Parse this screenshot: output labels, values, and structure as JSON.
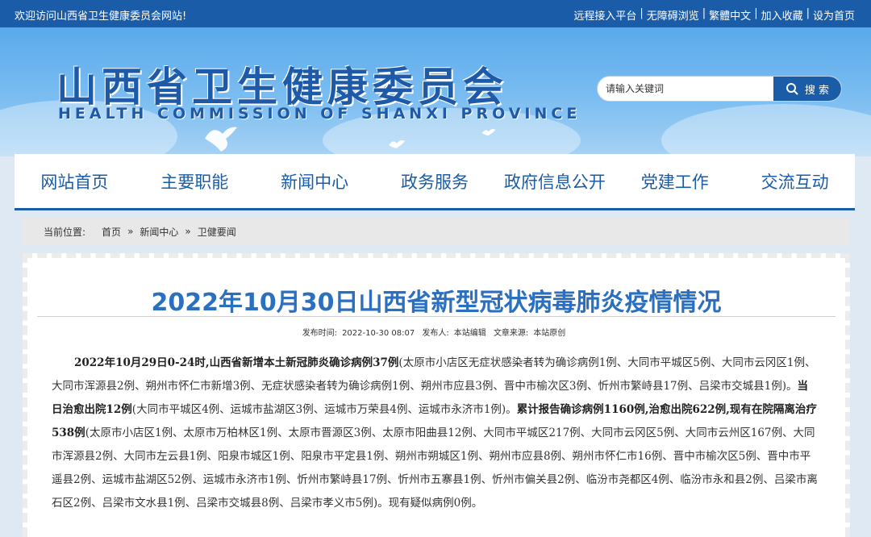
{
  "topbar": {
    "welcome": "欢迎访问山西省卫生健康委员会网站!",
    "links": [
      "远程接入平台",
      "无障碍浏览",
      "繁體中文",
      "加入收藏",
      "设为首页"
    ]
  },
  "header": {
    "title_cn": "山西省卫生健康委员会",
    "title_en": "HEALTH COMMISSION OF SHANXI PROVINCE",
    "search_placeholder": "请输入关键词",
    "search_button": "搜 索"
  },
  "nav": {
    "items": [
      "网站首页",
      "主要职能",
      "新闻中心",
      "政务服务",
      "政府信息公开",
      "党建工作",
      "交流互动"
    ]
  },
  "breadcrumb": {
    "label": "当前位置:",
    "items": [
      "首页",
      "新闻中心",
      "卫健要闻"
    ],
    "separator": "»"
  },
  "article": {
    "title": "2022年10月30日山西省新型冠状病毒肺炎疫情情况",
    "meta_time_label": "发布时间:",
    "meta_time": "2022-10-30 08:07",
    "meta_author_label": "发布人:",
    "meta_author": "本站编辑",
    "meta_source_label": "文章来源:",
    "meta_source": "本站原创",
    "p1_b1": "2022年10月29日0-24时,山西省新增本土新冠肺炎确诊病例37例",
    "p1_t1": "(太原市小店区无症状感染者转为确诊病例1例、大同市平城区5例、大同市云冈区1例、大同市浑源县2例、朔州市怀仁市新增3例、无症状感染者转为确诊病例1例、朔州市应县3例、晋中市榆次区3例、忻州市繁峙县17例、吕梁市交城县1例)。",
    "p1_b2": "当日治愈出院12例",
    "p1_t2": "(大同市平城区4例、运城市盐湖区3例、运城市万荣县4例、运城市永济市1例)。",
    "p1_b3": "累计报告确诊病例1160例,治愈出院622例,现有在院隔离治疗538例",
    "p1_t3": "(太原市小店区1例、太原市万柏林区1例、太原市晋源区3例、太原市阳曲县12例、大同市平城区217例、大同市云冈区5例、大同市云州区167例、大同市浑源县2例、大同市左云县1例、阳泉市城区1例、阳泉市平定县1例、朔州市朔城区1例、朔州市应县8例、朔州市怀仁市16例、晋中市榆次区5例、晋中市平遥县2例、运城市盐湖区52例、运城市永济市1例、忻州市繁峙县17例、忻州市五寨县1例、忻州市偏关县2例、临汾市尧都区4例、临汾市永和县2例、吕梁市离石区2例、吕梁市文水县1例、吕梁市交城县8例、吕梁市孝义市5例)。现有疑似病例0例。"
  },
  "colors": {
    "primary": "#1a5ca8",
    "title": "#2a6fc0"
  }
}
